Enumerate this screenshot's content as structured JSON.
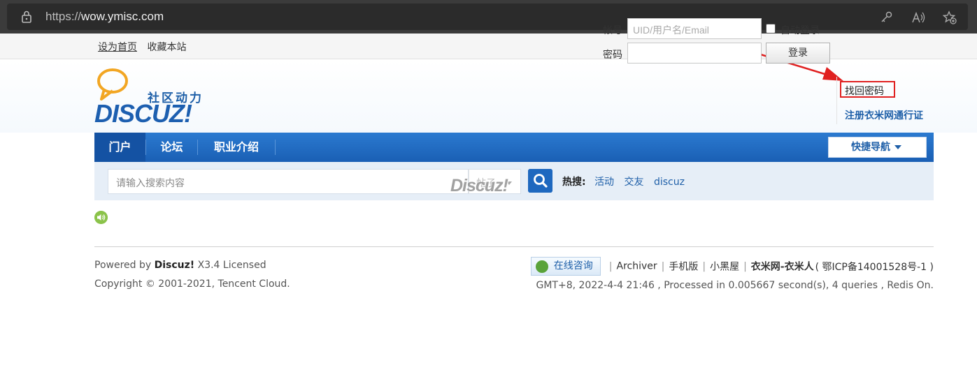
{
  "browser": {
    "url_prefix": "https://",
    "url_domain": "wow.ymisc.com"
  },
  "topbar": {
    "set_home": "设为首页",
    "bookmark": "收藏本站"
  },
  "logo": {
    "tagline": "社区动力",
    "wordmark": "DISCUZ!"
  },
  "login": {
    "account_label": "帐号",
    "account_placeholder": "UID/用户名/Email",
    "password_label": "密码",
    "auto_login": "自动登录",
    "login_button": "登录",
    "find_password": "找回密码",
    "register": "注册衣米网通行证"
  },
  "nav": {
    "items": [
      {
        "label": "门户"
      },
      {
        "label": "论坛"
      },
      {
        "label": "职业介绍"
      }
    ],
    "quick_nav": "快捷导航"
  },
  "search": {
    "placeholder": "请输入搜索内容",
    "type": "帖子",
    "hot_label": "热搜:",
    "hot_items": [
      "活动",
      "交友",
      "discuz"
    ],
    "watermark": "Discuz!"
  },
  "footer": {
    "powered_prefix": "Powered by ",
    "powered_brand": "Discuz!",
    "powered_suffix": " X3.4 Licensed",
    "copyright": "Copyright © 2001-2021, Tencent Cloud.",
    "consult": "在线咨询",
    "archiver": "Archiver",
    "mobile": "手机版",
    "blackroom": "小黑屋",
    "site_name": "衣米网-衣米人",
    "icp": "( 鄂ICP备14001528号-1 )",
    "stats": "GMT+8, 2022-4-4 21:46 , Processed in 0.005667 second(s), 4 queries , Redis On."
  },
  "colors": {
    "nav_blue": "#1a5fb4",
    "link_blue": "#1e5fa8",
    "highlight_red": "#e02020"
  }
}
